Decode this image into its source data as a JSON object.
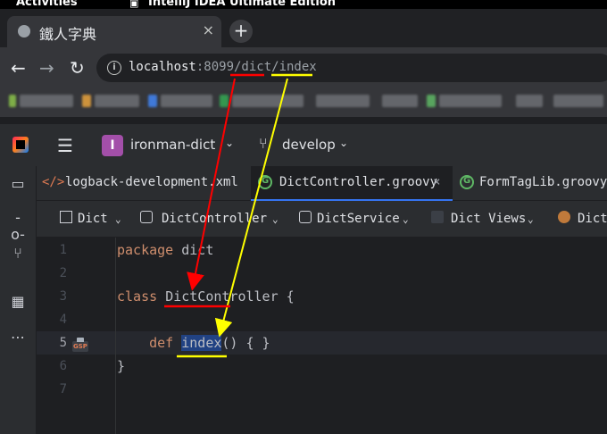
{
  "os_bar": {
    "activities": "Activities",
    "app_name": "IntelliJ IDEA Ultimate Edition"
  },
  "browser": {
    "tab_title": "鐵人字典",
    "tab_close": "×",
    "new_tab": "+",
    "back": "←",
    "forward": "→",
    "reload": "↻",
    "site_info": "i",
    "url_host": "localhost",
    "url_rest": ":8099/dict/index"
  },
  "ide": {
    "project_initial": "I",
    "project_name": "ironman-dict",
    "branch": "develop",
    "editor_tabs": [
      {
        "label": "logback-development.xml",
        "icon": "xml-file-icon",
        "icon_text": "</>"
      },
      {
        "label": "DictController.groovy",
        "icon": "groovy-file-icon",
        "active": true
      },
      {
        "label": "FormTagLib.groovy",
        "icon": "groovy-file-icon"
      }
    ],
    "tab_close": "×",
    "breadcrumbs": [
      {
        "label": "Dict",
        "icon": "table-icon"
      },
      {
        "label": "DictController",
        "icon": "groovy-class-icon"
      },
      {
        "label": "DictService",
        "icon": "service-icon"
      },
      {
        "label": "Dict Views",
        "icon": "gsp-icon"
      },
      {
        "label": "Dict",
        "icon": "grails-icon"
      }
    ],
    "line_numbers": [
      "1",
      "2",
      "3",
      "4",
      "5",
      "6",
      "7"
    ],
    "current_line": "5",
    "gsp_marker": "GSP",
    "code": {
      "line1_kw": "package",
      "line1_rest": " dict",
      "line3_kw": "class",
      "line3_class": "DictController",
      "line3_rest": " {",
      "line5_indent": "    ",
      "line5_kw": "def",
      "line5_method": "index",
      "line5_rest": "() { }",
      "line6": "}"
    },
    "tools": [
      "folder-icon",
      "commit-icon",
      "pull-request-icon",
      "structure-icon",
      "more-icon"
    ]
  },
  "colors": {
    "annotation_red": "#ff0000",
    "annotation_yellow": "#ffff00",
    "keyword": "#cf8e6d",
    "selection": "#214283"
  }
}
